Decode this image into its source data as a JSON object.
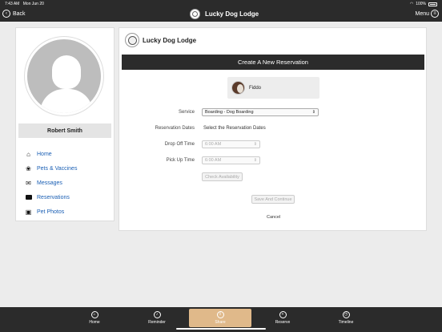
{
  "status": {
    "time": "7:43 AM",
    "date": "Mon Jun 20",
    "battery": "100%"
  },
  "nav": {
    "back_label": "Back",
    "title": "Lucky Dog Lodge",
    "menu_label": "Menu"
  },
  "sidebar": {
    "user_name": "Robert Smith",
    "items": [
      {
        "label": "Home",
        "icon": "home-icon"
      },
      {
        "label": "Pets & Vaccines",
        "icon": "paw-icon"
      },
      {
        "label": "Messages",
        "icon": "envelope-icon"
      },
      {
        "label": "Reservations",
        "icon": "calendar-icon"
      },
      {
        "label": "Pet Photos",
        "icon": "photos-icon"
      }
    ]
  },
  "card": {
    "header_title": "Lucky Dog Lodge",
    "res_title": "Create A New Reservation",
    "pet_name": "Fiddo",
    "service_label": "Service",
    "service_value": "Boarding - Dog Boarding",
    "dates_label": "Reservation Dates",
    "dates_value": "Select the Reservation Dates",
    "dropoff_label": "Drop Off Time",
    "dropoff_value": "6:00 AM",
    "pickup_label": "Pick Up Time",
    "pickup_value": "6:00 AM",
    "check_label": "Check Availability",
    "save_label": "Save And Continue",
    "cancel_label": "Cancel"
  },
  "tabs": [
    {
      "label": "Home",
      "icon": "home-icon",
      "active": false
    },
    {
      "label": "Reminder",
      "icon": "bell-icon",
      "active": false
    },
    {
      "label": "Share",
      "icon": "share-icon",
      "active": true
    },
    {
      "label": "Reserve",
      "icon": "plus-icon",
      "active": false
    },
    {
      "label": "Timeline",
      "icon": "timeline-icon",
      "active": false
    }
  ],
  "colors": {
    "bar": "#2b2b2b",
    "link": "#1a5fb4",
    "active_tab": "#e0b98a"
  }
}
